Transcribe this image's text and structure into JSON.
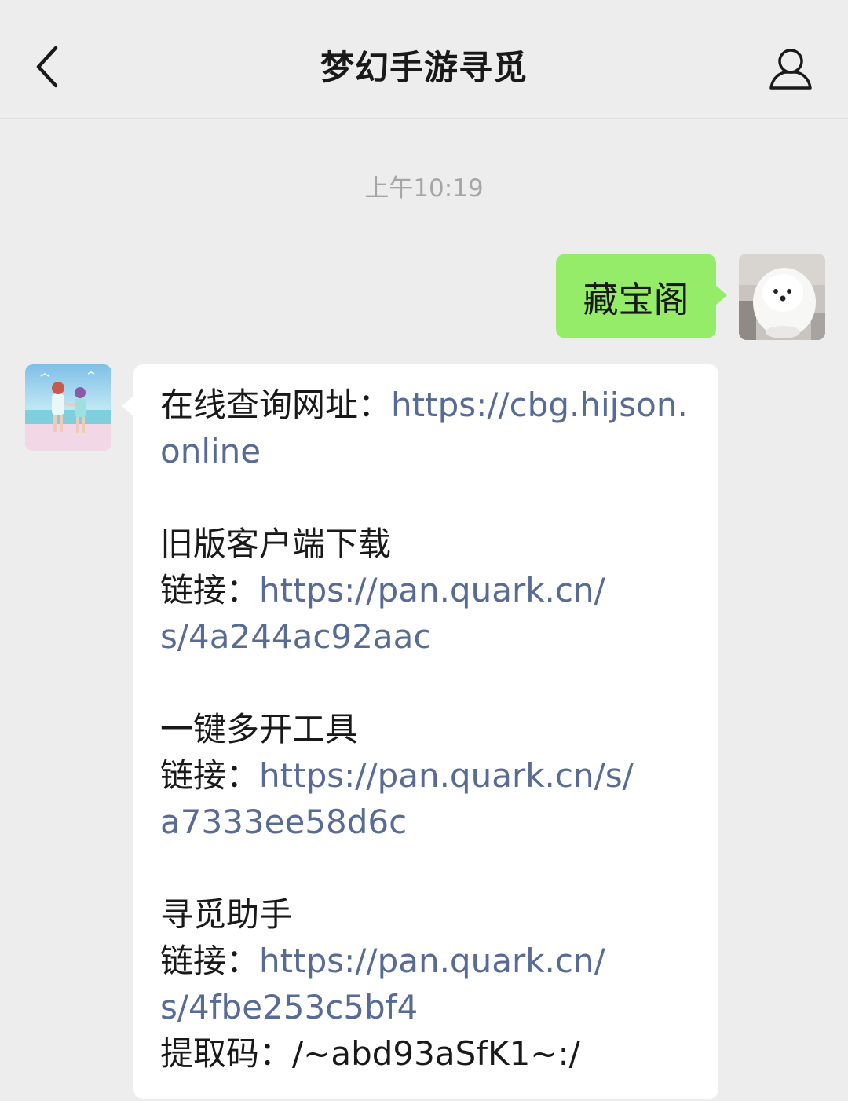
{
  "header": {
    "title": "梦幻手游寻觅",
    "back_icon": "chevron-left-icon",
    "profile_icon": "person-icon"
  },
  "timestamp": "上午10:19",
  "sent_message": {
    "text": "藏宝阁",
    "bubble_color": "#95ec69"
  },
  "received_message": {
    "line1_label": "在线查询网址：",
    "line1_link": "https://cbg.hijson.",
    "line2_link": "online",
    "section2_title": "旧版客户端下载",
    "section2_label": "链接：",
    "section2_link_a": "https://pan.quark.cn/",
    "section2_link_b": "s/4a244ac92aac",
    "section3_title": "一键多开工具",
    "section3_label": "链接：",
    "section3_link_a": "https://pan.quark.cn/s/",
    "section3_link_b": "a7333ee58d6c",
    "section4_title": "寻觅助手",
    "section4_label": "链接：",
    "section4_link_a": "https://pan.quark.cn/",
    "section4_link_b": "s/4fbe253c5bf4",
    "code_label": "提取码：",
    "code_value": "/~abd93aSfK1~:/"
  },
  "colors": {
    "background": "#ededed",
    "link": "#576b95",
    "timestamp": "#a6a6a6"
  }
}
